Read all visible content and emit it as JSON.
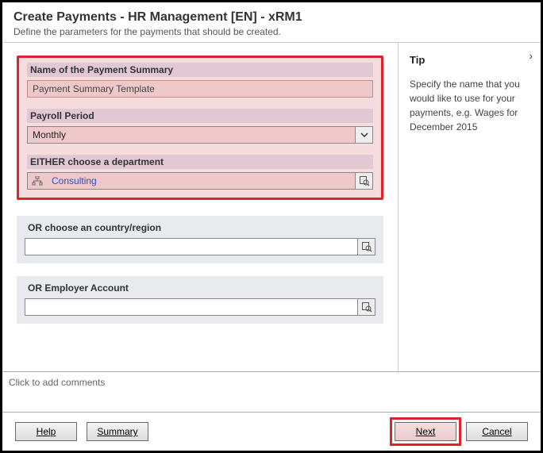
{
  "header": {
    "title": "Create Payments - HR Management [EN] - xRM1",
    "subtitle": "Define the parameters for the payments that should be created."
  },
  "fields": {
    "summary_name": {
      "label": "Name of the Payment Summary",
      "value": "Payment Summary Template"
    },
    "payroll_period": {
      "label": "Payroll Period",
      "value": "Monthly"
    },
    "department": {
      "label": "EITHER choose a department",
      "value": "Consulting"
    },
    "country": {
      "label": "OR choose an country/region",
      "value": ""
    },
    "employer": {
      "label": "OR Employer Account",
      "value": ""
    }
  },
  "tip": {
    "heading": "Tip",
    "body": "Specify the name that you would like to use for your payments, e.g. Wages for December 2015"
  },
  "comments_placeholder": "Click to add comments",
  "buttons": {
    "help": "Help",
    "summary": "Summary",
    "next": "Next",
    "cancel": "Cancel"
  }
}
